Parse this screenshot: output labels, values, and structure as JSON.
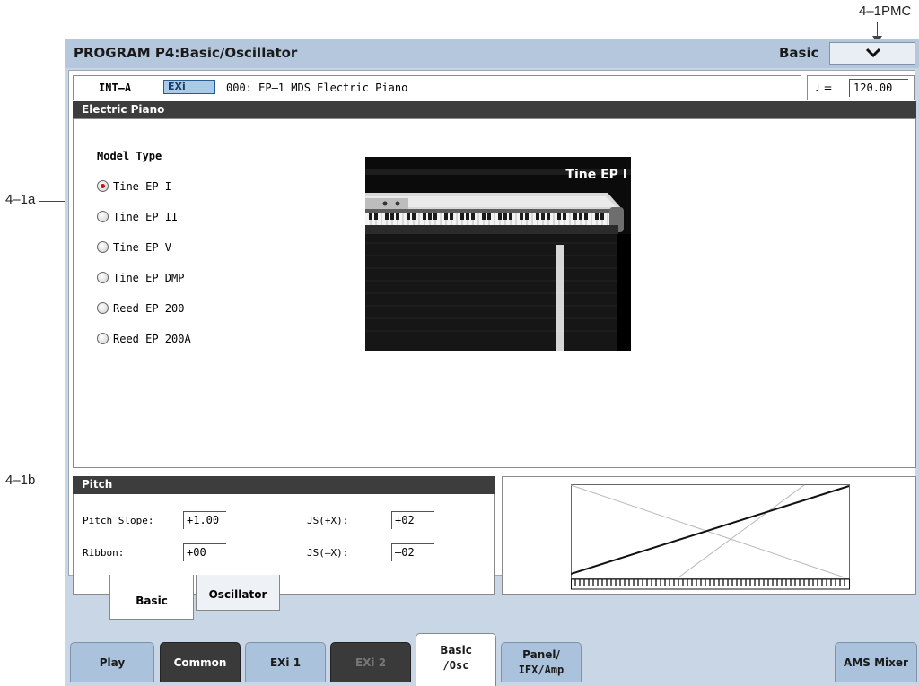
{
  "callouts": {
    "top_right": "4–1PMC",
    "left_a": "4–1a",
    "left_b": "4–1b"
  },
  "header": {
    "title": "PROGRAM P4:Basic/Oscillator",
    "page_select_label": "Basic"
  },
  "program": {
    "bank": "INT–A",
    "engine": "EXi",
    "name": "000: EP–1 MDS Electric Piano"
  },
  "tempo": {
    "symbol": "♩ =",
    "value": "120.00"
  },
  "electric_piano": {
    "header": "Electric Piano",
    "model_type_label": "Model Type",
    "models": [
      {
        "label": "Tine EP I",
        "selected": true
      },
      {
        "label": "Tine EP II",
        "selected": false
      },
      {
        "label": "Tine EP V",
        "selected": false
      },
      {
        "label": "Tine EP DMP",
        "selected": false
      },
      {
        "label": "Reed EP 200",
        "selected": false
      },
      {
        "label": "Reed EP 200A",
        "selected": false
      }
    ],
    "image_caption": "Tine EP I"
  },
  "pitch": {
    "header": "Pitch",
    "pitch_slope_label": "Pitch Slope:",
    "pitch_slope_value": "+1.00",
    "ribbon_label": "Ribbon:",
    "ribbon_value": "+00",
    "js_plus_x_label": "JS(+X):",
    "js_plus_x_value": "+02",
    "js_minus_x_label": "JS(–X):",
    "js_minus_x_value": "–02"
  },
  "sub_tabs": [
    "Basic",
    "Oscillator"
  ],
  "main_tabs": {
    "play": "Play",
    "common": "Common",
    "exi1": "EXi 1",
    "exi2": "EXi 2",
    "basic_osc_line1": "Basic",
    "basic_osc_line2": "/Osc",
    "panel_line1": "Panel/",
    "panel_line2": "IFX/Amp",
    "ams_mixer": "AMS Mixer"
  },
  "colors": {
    "screen_bg": "#c8d6e6",
    "title_bar": "#b5c7dc",
    "section_header": "#3d3d3d",
    "radio_selected": "#d01010",
    "tab_dark": "#3a3a3a",
    "tab_blue": "#aac2dc"
  }
}
